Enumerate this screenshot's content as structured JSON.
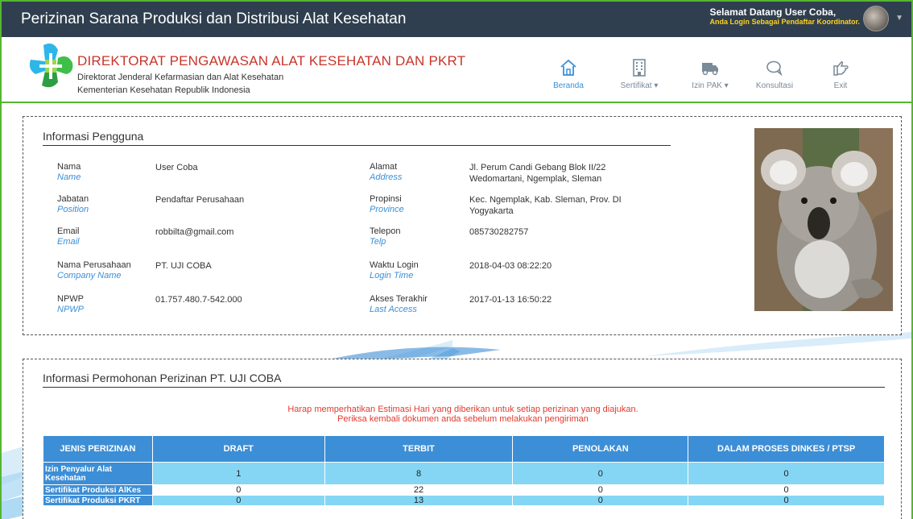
{
  "app": {
    "title": "Perizinan Sarana Produksi dan Distribusi Alat Kesehatan",
    "welcome": "Selamat Datang User Coba,",
    "role_note": "Anda Login Sebagai Pendaftar Koordinator."
  },
  "org": {
    "title": "DIREKTORAT PENGAWASAN ALAT KESEHATAN DAN PKRT",
    "sub1": "Direktorat Jenderal Kefarmasian dan Alat Kesehatan",
    "sub2": "Kementerian Kesehatan Republik Indonesia"
  },
  "nav": [
    {
      "label": "Beranda",
      "icon": "home-icon"
    },
    {
      "label": "Sertifikat ▾",
      "icon": "building-icon"
    },
    {
      "label": "Izin PAK ▾",
      "icon": "truck-icon"
    },
    {
      "label": "Konsultasi",
      "icon": "chat-icon"
    },
    {
      "label": "Exit",
      "icon": "exit-icon"
    }
  ],
  "info": {
    "title": "Informasi Pengguna",
    "left": [
      {
        "label": "Nama",
        "label_en": "Name",
        "value": "User Coba"
      },
      {
        "label": "Jabatan",
        "label_en": "Position",
        "value": "Pendaftar Perusahaan"
      },
      {
        "label": "Email",
        "label_en": "Email",
        "value": "robbilta@gmail.com"
      },
      {
        "label": "Nama Perusahaan",
        "label_en": "Company Name",
        "value": "PT. UJI COBA"
      },
      {
        "label": "NPWP",
        "label_en": "NPWP",
        "value": "01.757.480.7-542.000"
      }
    ],
    "right": [
      {
        "label": "Alamat",
        "label_en": "Address",
        "value": "Jl. Perum Candi Gebang Blok II/22",
        "value2": "Wedomartani, Ngemplak, Sleman"
      },
      {
        "label": "Propinsi",
        "label_en": "Province",
        "value": "Kec. Ngemplak, Kab. Sleman, Prov. DI",
        "value2": "Yogyakarta"
      },
      {
        "label": "Telepon",
        "label_en": "Telp",
        "value": "085730282757",
        "value2": ""
      },
      {
        "label": "Waktu Login",
        "label_en": "Login Time",
        "value": "2018-04-03 08:22:20",
        "value2": ""
      },
      {
        "label": "Akses Terakhir",
        "label_en": "Last Access",
        "value": "2017-01-13 16:50:22",
        "value2": ""
      }
    ]
  },
  "permohonan": {
    "title": "Informasi Permohonan Perizinan PT. UJI COBA",
    "notice1": "Harap memperhatikan Estimasi Hari yang diberikan untuk setiap perizinan yang diajukan.",
    "notice2": "Periksa kembali dokumen anda sebelum melakukan pengiriman",
    "headers": [
      "JENIS PERIZINAN",
      "DRAFT",
      "TERBIT",
      "PENOLAKAN",
      "DALAM PROSES DINKES / PTSP"
    ],
    "rows": [
      {
        "name": "Izin Penyalur Alat Kesehatan",
        "draft": "1",
        "terbit": "8",
        "penolakan": "0",
        "proses": "0"
      },
      {
        "name": "Sertifikat Produksi AlKes",
        "draft": "0",
        "terbit": "22",
        "penolakan": "0",
        "proses": "0"
      },
      {
        "name": "Sertifikat Produksi PKRT",
        "draft": "0",
        "terbit": "13",
        "penolakan": "0",
        "proses": "0"
      }
    ]
  }
}
